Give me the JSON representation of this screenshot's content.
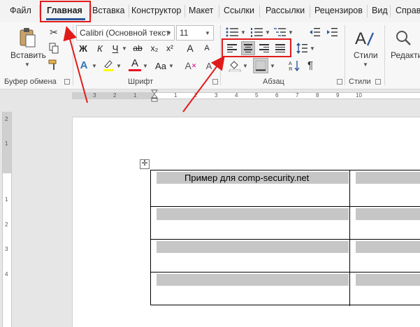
{
  "tabs": [
    {
      "label": "Файл"
    },
    {
      "label": "Главная"
    },
    {
      "label": "Вставка"
    },
    {
      "label": "Конструктор"
    },
    {
      "label": "Макет"
    },
    {
      "label": "Ссылки"
    },
    {
      "label": "Рассылки"
    },
    {
      "label": "Рецензиров"
    },
    {
      "label": "Вид"
    },
    {
      "label": "Справ"
    }
  ],
  "ribbon": {
    "clipboard": {
      "group_label": "Буфер обмена",
      "paste_label": "Вставить"
    },
    "font": {
      "group_label": "Шрифт",
      "font_name": "Calibri (Основной текст",
      "font_size": "11",
      "bold": "Ж",
      "italic": "К",
      "underline": "Ч",
      "strike": "ab",
      "subscript": "x₂",
      "superscript": "x²",
      "case": "Aa",
      "grow": "A",
      "shrink": "A",
      "text_effects": "A",
      "font_color": "A",
      "font_color_value": "#e81123",
      "highlight_value": "#ffff00"
    },
    "paragraph": {
      "group_label": "Абзац",
      "pilcrow": "¶"
    },
    "styles": {
      "group_label": "Стили",
      "styles_label": "Стили"
    },
    "editing": {
      "label": "Редакти"
    }
  },
  "ruler": {
    "h_labels": [
      "3",
      "2",
      "1",
      "1",
      "2",
      "3",
      "4",
      "5",
      "6",
      "7",
      "8",
      "9",
      "10"
    ],
    "v_labels": [
      "2",
      "1",
      "1",
      "2",
      "3",
      "4"
    ]
  },
  "document": {
    "table_rows": [
      {
        "cell1": "Пример для comp-security.net",
        "cell2": ""
      },
      {
        "cell1": "",
        "cell2": ""
      },
      {
        "cell1": "",
        "cell2": ""
      },
      {
        "cell1": "",
        "cell2": ""
      }
    ]
  },
  "annotation_color": "#e11b1b"
}
